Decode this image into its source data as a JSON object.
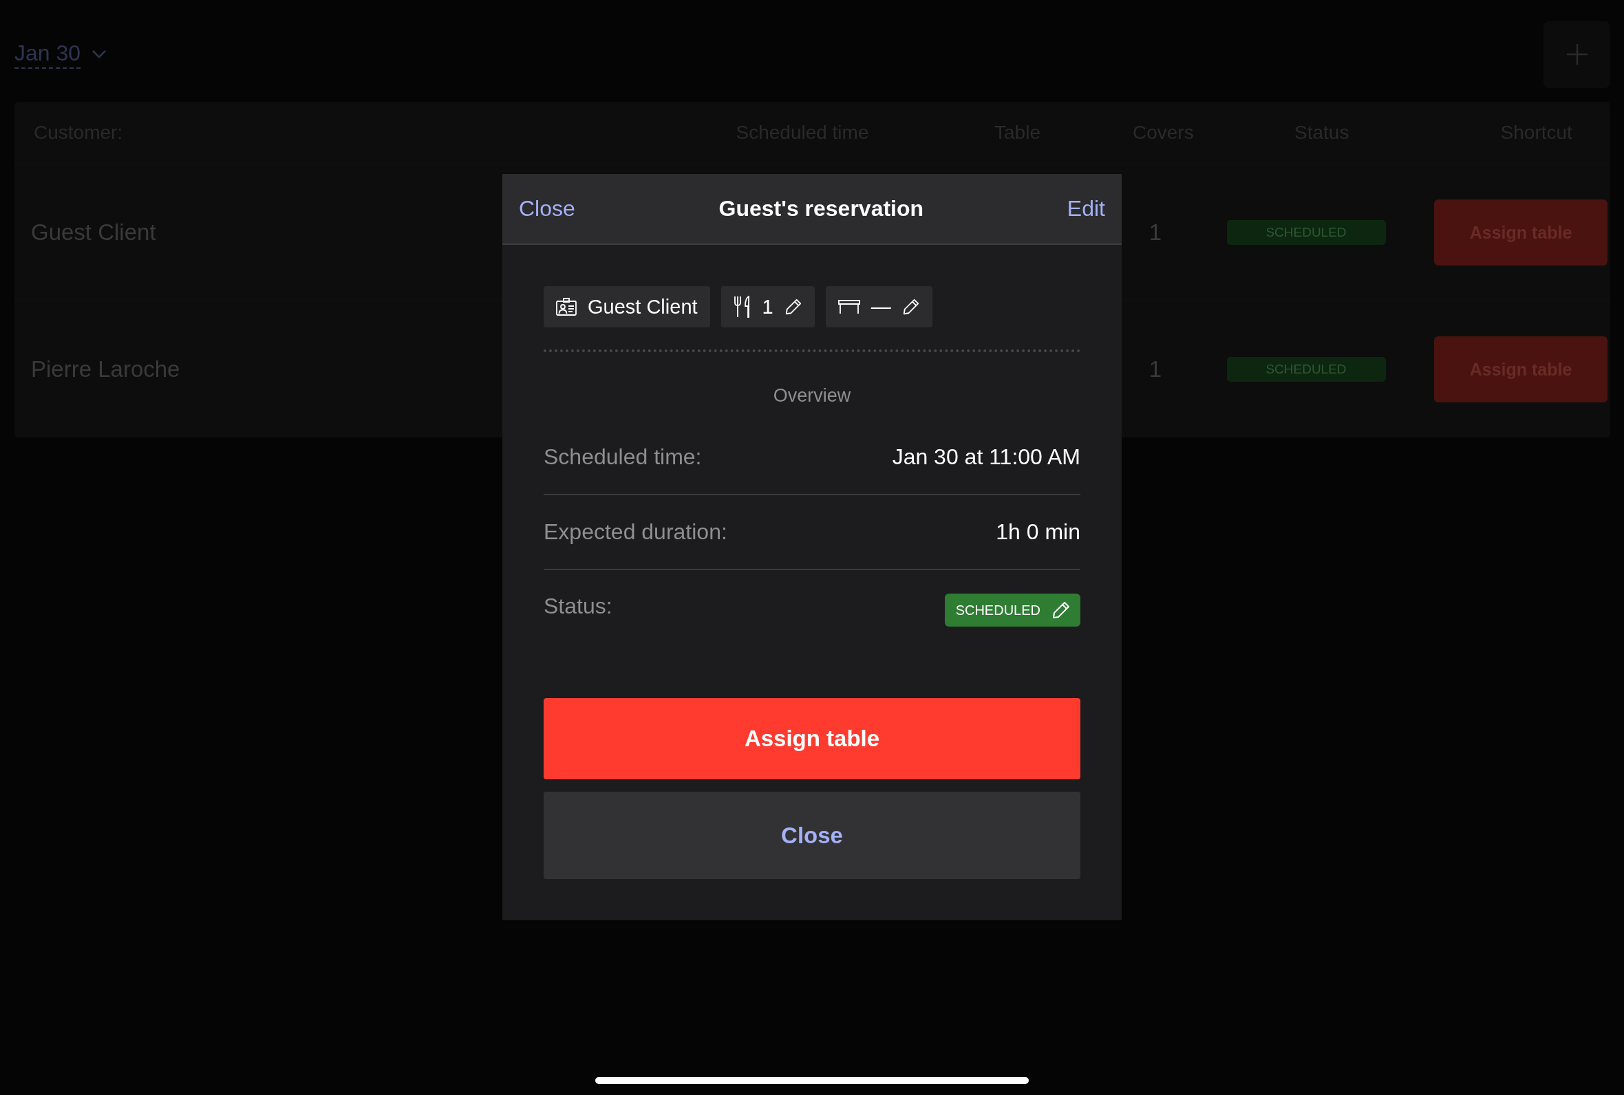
{
  "toolbar": {
    "date": "Jan 30"
  },
  "table": {
    "columns": [
      "Customer:",
      "Scheduled time",
      "Table",
      "Covers",
      "Status",
      "Shortcut"
    ],
    "rows": [
      {
        "customer": "Guest Client",
        "covers": "1",
        "status": "SCHEDULED",
        "shortcut": "Assign table"
      },
      {
        "customer": "Pierre Laroche",
        "covers": "1",
        "status": "SCHEDULED",
        "shortcut": "Assign table"
      }
    ]
  },
  "modal": {
    "close": "Close",
    "title": "Guest's reservation",
    "edit": "Edit",
    "chips": [
      {
        "kind": "guest",
        "text": "Guest Client",
        "editable": false
      },
      {
        "kind": "covers",
        "text": "1",
        "editable": true
      },
      {
        "kind": "table",
        "text": "—",
        "editable": true
      }
    ],
    "section": "Overview",
    "details": [
      {
        "label": "Scheduled time:",
        "value": "Jan 30 at 11:00 AM"
      },
      {
        "label": "Expected duration:",
        "value": "1h 0 min"
      }
    ],
    "status": {
      "label": "Status:",
      "value": "SCHEDULED",
      "editable": true
    },
    "primary_button": "Assign table",
    "secondary_button": "Close"
  }
}
